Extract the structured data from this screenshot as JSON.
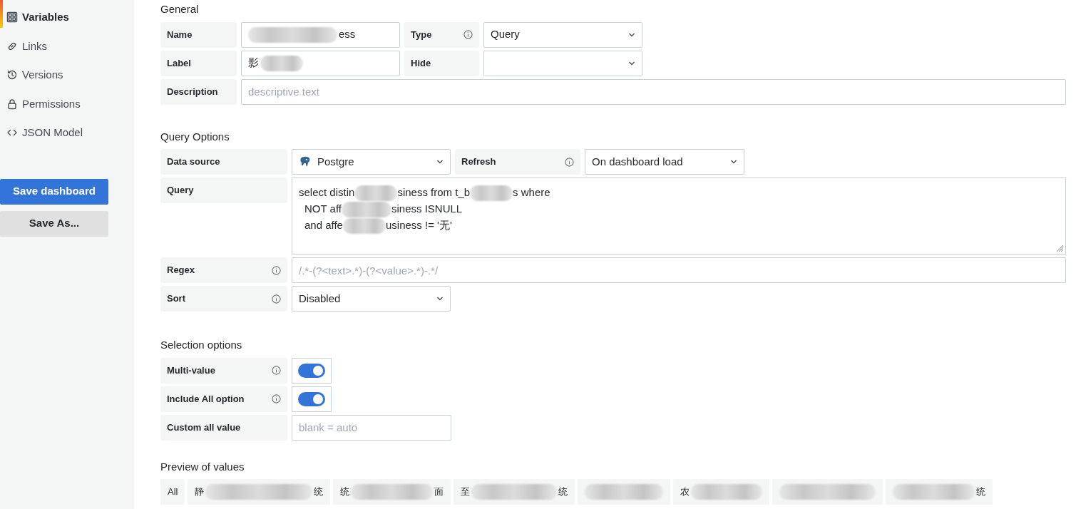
{
  "sidebar": {
    "items": [
      {
        "label": "Variables",
        "selected": true
      },
      {
        "label": "Links",
        "selected": false
      },
      {
        "label": "Versions",
        "selected": false
      },
      {
        "label": "Permissions",
        "selected": false
      },
      {
        "label": "JSON Model",
        "selected": false
      }
    ],
    "buttons": [
      {
        "label": "Save dashboard",
        "kind": "primary"
      },
      {
        "label": "Save As...",
        "kind": "secondary"
      }
    ]
  },
  "general": {
    "title": "General",
    "name": {
      "label": "Name",
      "value": {
        "end": "ess"
      }
    },
    "type": {
      "label": "Type",
      "info": true,
      "value": "Query"
    },
    "label": {
      "label": "Label",
      "value": {
        "start": "影"
      }
    },
    "hide": {
      "label": "Hide"
    },
    "description": {
      "label": "Description",
      "placeholder": "descriptive text"
    }
  },
  "query_options": {
    "title": "Query Options",
    "data_source": {
      "label": "Data source",
      "value": "Postgre"
    },
    "refresh": {
      "label": "Refresh",
      "info": true,
      "value": "On dashboard load"
    },
    "query": {
      "label": "Query",
      "lines": [
        [
          "select distin",
          "siness  from t_b",
          "s where"
        ],
        [
          "NOT aff",
          "siness ISNULL"
        ],
        [
          "and affe",
          "usiness != '无'"
        ]
      ]
    },
    "regex": {
      "label": "Regex",
      "info": true,
      "placeholder": "/.*-(?<text>.*)-(?<value>.*)-.*/"
    },
    "sort": {
      "label": "Sort",
      "info": true,
      "value": "Disabled"
    }
  },
  "selection_options": {
    "title": "Selection options",
    "multi_value": {
      "label": "Multi-value",
      "info": true,
      "on": true
    },
    "include_all": {
      "label": "Include All option",
      "info": true,
      "on": true
    },
    "custom_all_value": {
      "label": "Custom all value",
      "placeholder": "blank = auto"
    }
  },
  "preview": {
    "title": "Preview of values",
    "values": [
      {
        "kind": "plain",
        "text": "All"
      },
      {
        "kind": "redacted",
        "start": "静",
        "end": "统"
      },
      {
        "kind": "redacted",
        "start": "统",
        "end": "面"
      },
      {
        "kind": "redacted",
        "start": "至",
        "end": "统"
      },
      {
        "kind": "redacted"
      },
      {
        "kind": "redacted",
        "start": "农"
      },
      {
        "kind": "redacted"
      },
      {
        "kind": "redacted",
        "end": "统"
      }
    ]
  }
}
